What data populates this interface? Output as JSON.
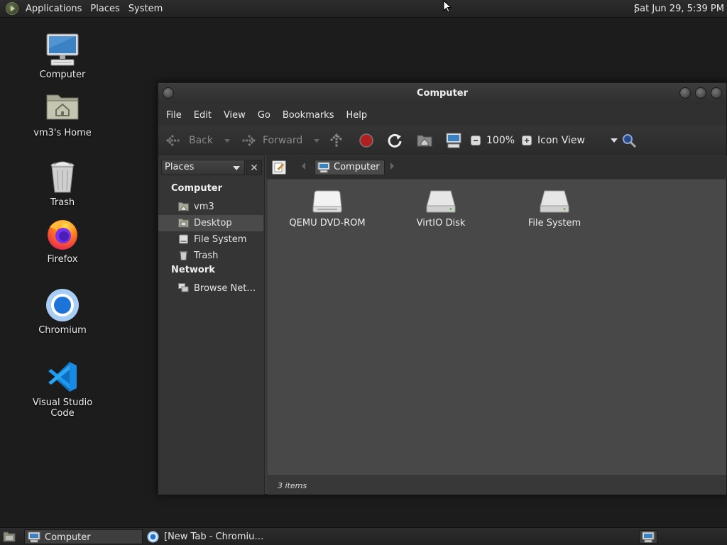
{
  "top_panel": {
    "menus": [
      "Applications",
      "Places",
      "System"
    ],
    "clock": "Sat Jun 29,  5:39 PM"
  },
  "desktop": {
    "icons": [
      {
        "label": "Computer",
        "icon": "computer-icon"
      },
      {
        "label": "vm3's Home",
        "icon": "home-folder-icon"
      },
      {
        "label": "Trash",
        "icon": "trash-icon"
      },
      {
        "label": "Firefox",
        "icon": "firefox-icon"
      },
      {
        "label": "Chromium",
        "icon": "chromium-icon"
      },
      {
        "label": "Visual Studio Code",
        "icon": "vscode-icon"
      }
    ]
  },
  "window": {
    "title": "Computer",
    "menubar": [
      "File",
      "Edit",
      "View",
      "Go",
      "Bookmarks",
      "Help"
    ],
    "toolbar": {
      "back": "Back",
      "forward": "Forward",
      "zoom": "100%",
      "view_mode": "Icon View"
    },
    "location": {
      "current": "Computer"
    },
    "sidebar": {
      "selector": "Places",
      "sections": [
        {
          "title": "Computer",
          "items": [
            {
              "label": "vm3",
              "icon": "home-folder-icon"
            },
            {
              "label": "Desktop",
              "icon": "desktop-folder-icon",
              "selected": true
            },
            {
              "label": "File System",
              "icon": "drive-icon"
            },
            {
              "label": "Trash",
              "icon": "trash-icon"
            }
          ]
        },
        {
          "title": "Network",
          "items": [
            {
              "label": "Browse Net…",
              "icon": "network-icon"
            }
          ]
        }
      ]
    },
    "content": {
      "items": [
        {
          "label": "QEMU DVD-ROM",
          "icon": "optical-drive-icon"
        },
        {
          "label": "VirtIO Disk",
          "icon": "hard-disk-icon"
        },
        {
          "label": "File System",
          "icon": "hard-disk-icon"
        }
      ]
    },
    "status": "3 items"
  },
  "taskbar": {
    "tasks": [
      {
        "label": "Computer",
        "icon": "computer-icon",
        "active": true
      },
      {
        "label": "[New Tab - Chromiu…",
        "icon": "chromium-icon",
        "active": false
      }
    ]
  },
  "colors": {
    "desktop_bg": "#1c1c1c",
    "window_bg": "#3b3b3b",
    "content_bg": "#484848",
    "accent_blue": "#1e88e5"
  }
}
